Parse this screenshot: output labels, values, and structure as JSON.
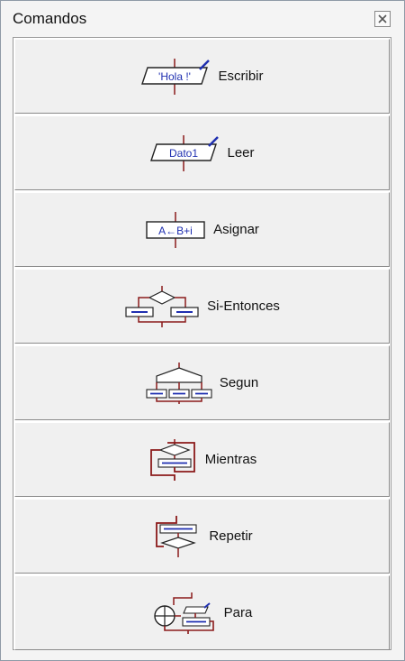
{
  "window": {
    "title": "Comandos"
  },
  "colors": {
    "flow": "#8b1a1a",
    "text_blue": "#1f2fb0",
    "button_face": "#f0f0f0"
  },
  "commands": [
    {
      "label": "Escribir",
      "icon": "write-output-icon",
      "icon_text": "'Hola !'"
    },
    {
      "label": "Leer",
      "icon": "read-input-icon",
      "icon_text": "Dato1"
    },
    {
      "label": "Asignar",
      "icon": "assignment-icon",
      "icon_text": "A←B+i"
    },
    {
      "label": "Si-Entonces",
      "icon": "if-then-icon"
    },
    {
      "label": "Segun",
      "icon": "switch-case-icon"
    },
    {
      "label": "Mientras",
      "icon": "while-loop-icon"
    },
    {
      "label": "Repetir",
      "icon": "repeat-loop-icon"
    },
    {
      "label": "Para",
      "icon": "for-loop-icon"
    }
  ]
}
